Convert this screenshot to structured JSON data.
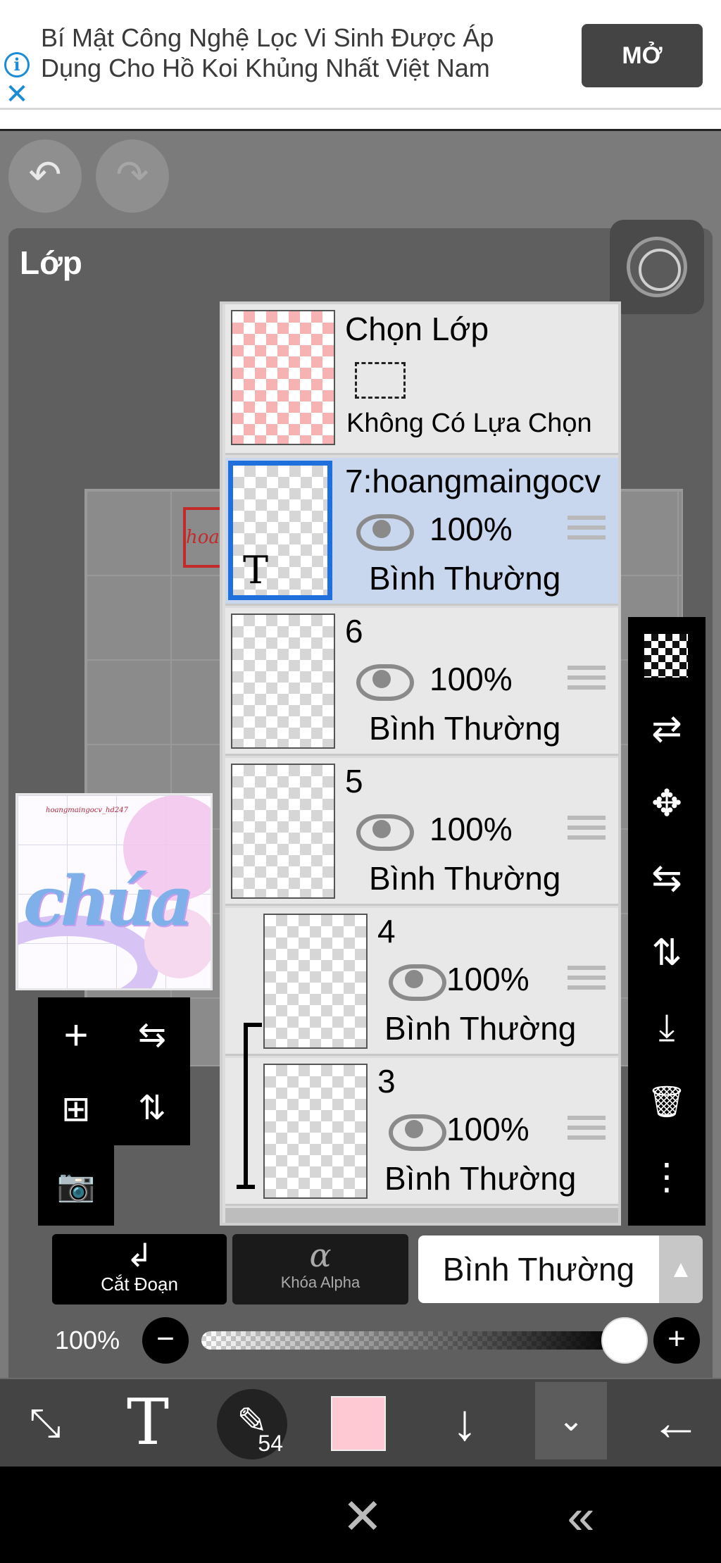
{
  "ad": {
    "text_line1": "Bí Mật Công Nghệ Lọc Vi Sinh Được Áp",
    "text_line2": "Dụng Cho Hồ Koi Khủng Nhất Việt Nam",
    "open_label": "MỞ",
    "info_icon": "i",
    "close_icon": "✕"
  },
  "history": {
    "undo_icon": "↶",
    "redo_icon": "↷"
  },
  "panel": {
    "title": "Lớp"
  },
  "canvas": {
    "label_fragment": "hoai",
    "thumb_caption": "hoangmaingocv_hd247",
    "thumb_script": "chúa"
  },
  "selection_layer": {
    "title": "Chọn Lớp",
    "status": "Không Có Lựa Chọn"
  },
  "layers": [
    {
      "name": "7:hoangmaingocv",
      "opacity": "100%",
      "blend": "Bình Thường",
      "type_badge": "T",
      "selected": true
    },
    {
      "name": "6",
      "opacity": "100%",
      "blend": "Bình Thường"
    },
    {
      "name": "5",
      "opacity": "100%",
      "blend": "Bình Thường"
    },
    {
      "name": "4",
      "opacity": "100%",
      "blend": "Bình Thường",
      "clipped": true
    },
    {
      "name": "3",
      "opacity": "100%",
      "blend": "Bình Thường",
      "clipped": true
    }
  ],
  "left_tools": {
    "add_icon": "+",
    "flip_h_icon": "⇆",
    "add_copy_icon": "⊞",
    "flip_v_icon": "⇅",
    "camera_icon": "📷"
  },
  "right_tools": {
    "move_icon": "✥",
    "transfer_icon": "⇄",
    "flip_h_icon": "⇆",
    "flip_v_icon": "⇅",
    "merge_down_icon": "⤓",
    "delete_icon": "🗑",
    "more_icon": "⋮"
  },
  "layer_actions": {
    "clip_label": "Cắt Đoạn",
    "clip_icon": "↲",
    "alpha_label": "Khóa Alpha",
    "alpha_icon": "α",
    "blend_mode": "Bình Thường",
    "blend_arrow": "▲"
  },
  "opacity_slider": {
    "label": "100%",
    "value": 1.0,
    "minus": "−",
    "plus": "+"
  },
  "bottom_toolbar": {
    "transform_icon": "⤡",
    "text_icon": "T",
    "brush_icon": "✎",
    "brush_size": "54",
    "color": "#ffc9d4",
    "down_icon": "↓",
    "collapse_icon": "⌄",
    "back_icon": "←"
  },
  "nav": {
    "close_icon": "✕",
    "back_icon": "«"
  }
}
